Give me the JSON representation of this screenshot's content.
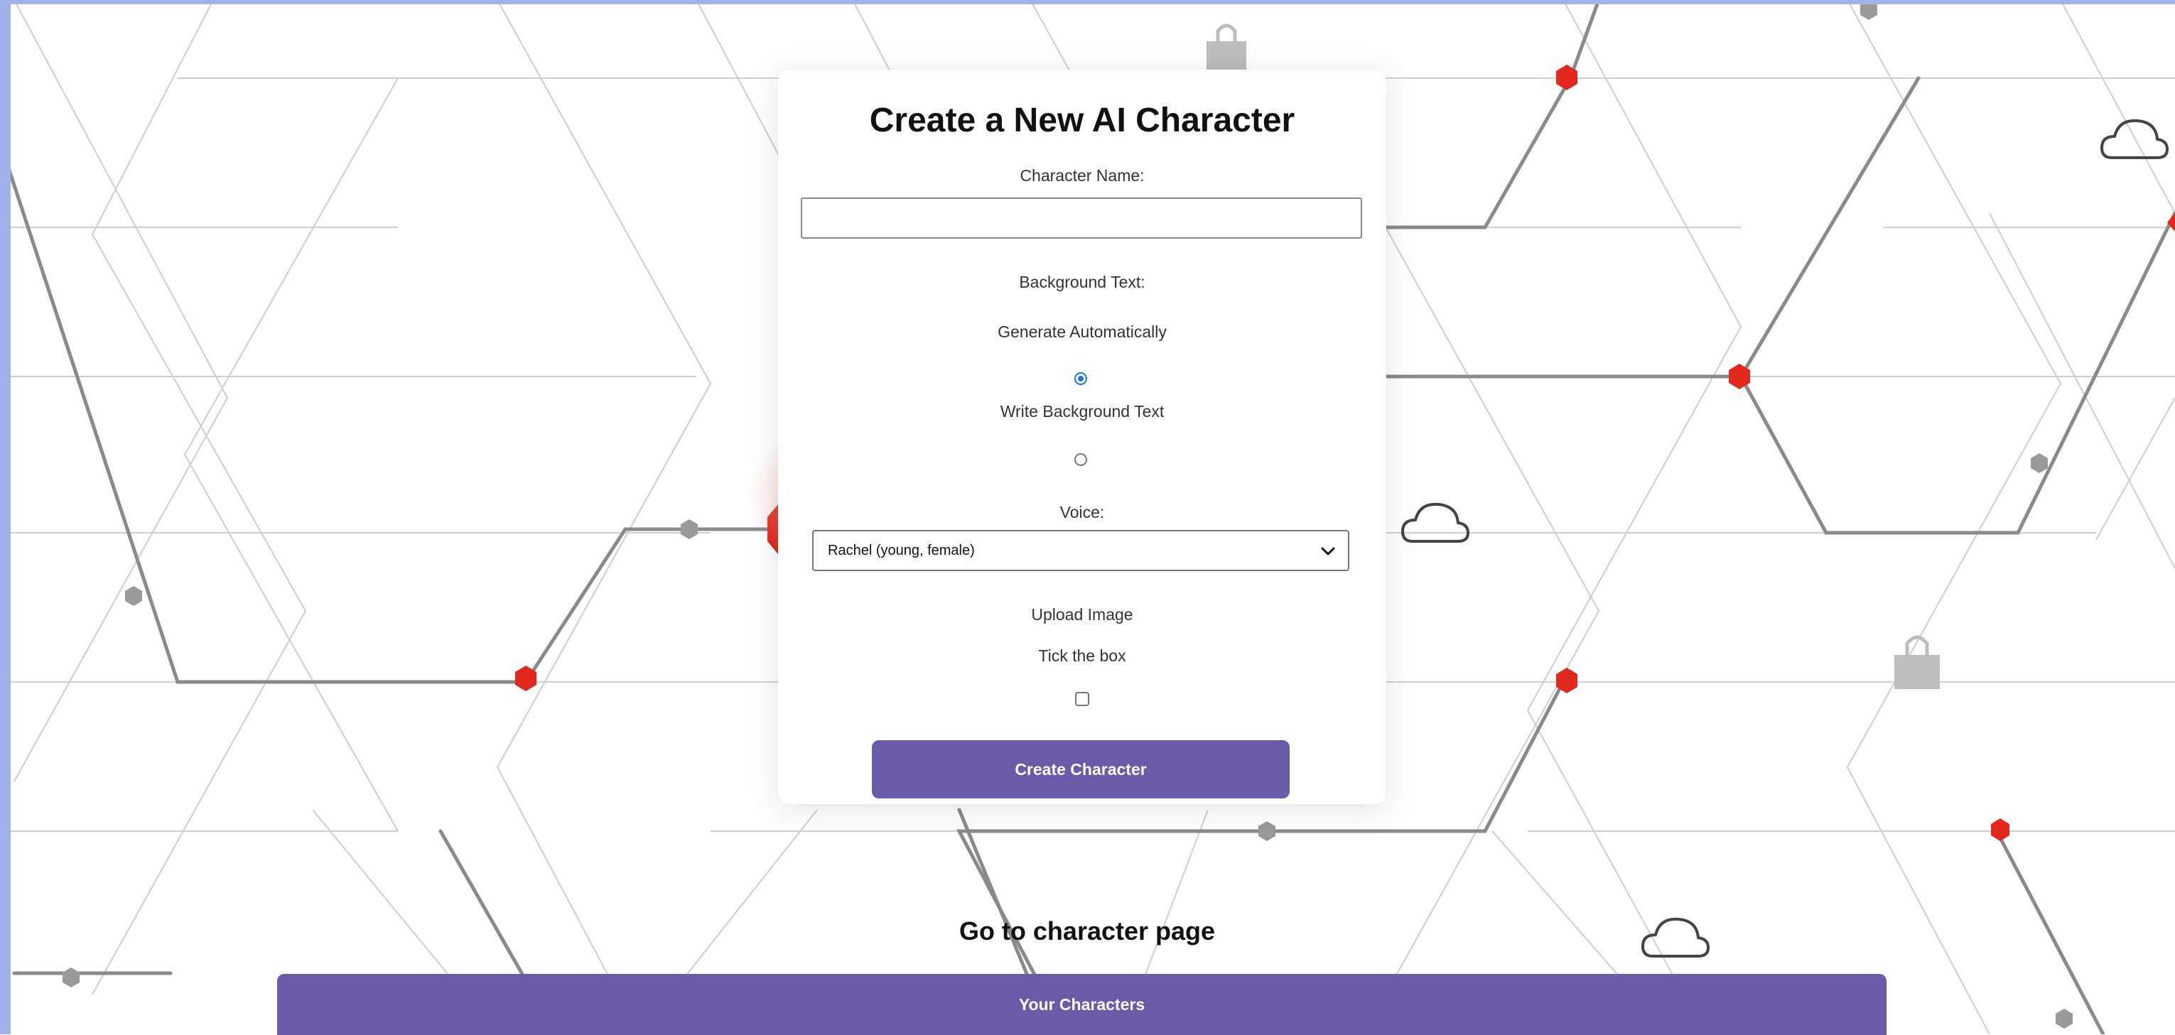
{
  "form": {
    "title": "Create a New AI Character",
    "name_label": "Character Name:",
    "name_value": "",
    "background_label": "Background Text:",
    "option_auto": "Generate Automatically",
    "option_write": "Write Background Text",
    "selected_option": "Generate Automatically",
    "voice_label": "Voice:",
    "voice_selected": "Rachel (young, female)",
    "upload_label": "Upload Image",
    "tick_label": "Tick the box",
    "upload_checked": false,
    "submit_label": "Create Character"
  },
  "nav": {
    "goto_label": "Go to character page",
    "your_characters_label": "Your Characters"
  },
  "colors": {
    "accent": "#6b5aa8",
    "radio_checked": "#1a73e8",
    "network_node": "#e0281f",
    "edge_strip": "#9fb3ea"
  },
  "icons": [
    "cloud-icon",
    "padlock-icon"
  ]
}
